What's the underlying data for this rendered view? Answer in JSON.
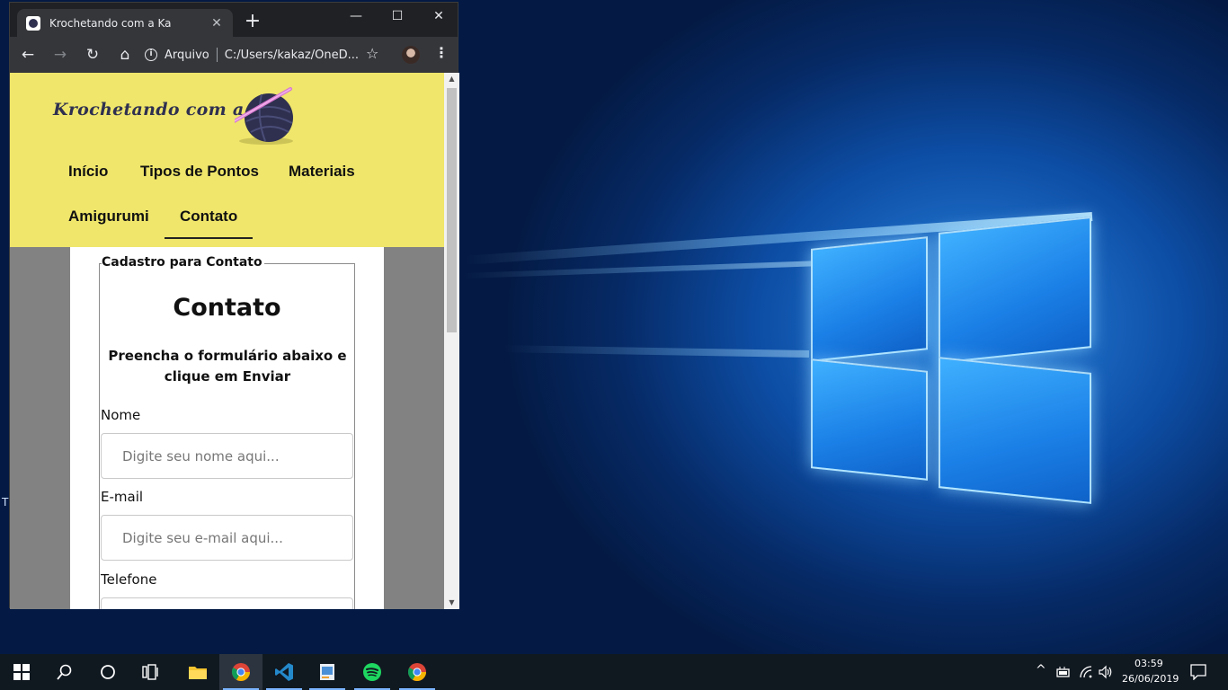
{
  "browser": {
    "tab_title": "Krochetando com a Ka",
    "tab_close": "✕",
    "new_tab": "+",
    "minimize": "—",
    "maximize": "☐",
    "close": "✕",
    "back_icon": "←",
    "forward_icon": "→",
    "reload_icon": "↻",
    "home_icon": "⌂",
    "info_icon": "i",
    "origin_label": "Arquivo",
    "url": "C:/Users/kakaz/OneD...",
    "star_icon": "☆",
    "menu_icon": "⋮"
  },
  "site": {
    "logo_text": "Krochetando com a Ka",
    "nav": [
      {
        "label": "Início"
      },
      {
        "label": "Tipos de Pontos"
      },
      {
        "label": "Materiais"
      },
      {
        "label": "Amigurumi"
      },
      {
        "label": "Contato",
        "active": true
      }
    ],
    "form": {
      "legend": "Cadastro para Contato",
      "title": "Contato",
      "subtitle": "Preencha o formulário abaixo e clique em Enviar",
      "fields": [
        {
          "label": "Nome",
          "placeholder": "Digite seu nome aqui..."
        },
        {
          "label": "E-mail",
          "placeholder": "Digite seu e-mail aqui..."
        },
        {
          "label": "Telefone",
          "placeholder": ""
        }
      ]
    }
  },
  "desktop": {
    "partial_label": "T"
  },
  "taskbar": {
    "apps": [
      {
        "name": "windows-start-icon"
      },
      {
        "name": "search-icon"
      },
      {
        "name": "cortana-icon"
      },
      {
        "name": "task-view-icon"
      },
      {
        "name": "file-explorer-icon"
      },
      {
        "name": "chrome-icon",
        "active": true
      },
      {
        "name": "vscode-icon"
      },
      {
        "name": "photo-app-icon"
      },
      {
        "name": "spotify-icon"
      },
      {
        "name": "chrome-icon"
      }
    ],
    "tray": {
      "chevron": "^",
      "time": "03:59",
      "date": "26/06/2019"
    }
  },
  "colors": {
    "header_yellow": "#efe66b",
    "logo_navy": "#2f3050",
    "page_gray": "#828282",
    "taskbar": "#101820",
    "chrome_dark": "#202124"
  }
}
